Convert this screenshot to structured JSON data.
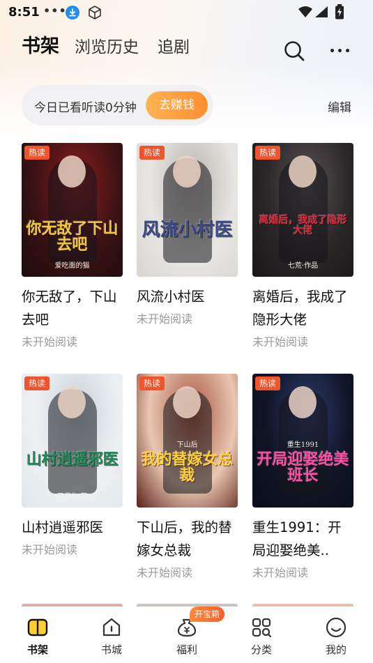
{
  "status_bar": {
    "time": "8:51",
    "dots": "•••"
  },
  "header": {
    "tabs": [
      {
        "label": "书架",
        "active": true
      },
      {
        "label": "浏览历史",
        "active": false
      },
      {
        "label": "追剧",
        "active": false
      }
    ]
  },
  "reading": {
    "text": "今日已看听读0分钟",
    "earn_label": "去赚钱"
  },
  "edit_label": "编辑",
  "books": [
    {
      "title": "你无敌了，下山去吧",
      "status": "未开始阅读",
      "badge": "热读",
      "cover_text": "你无敌了下山去吧",
      "cover_small": "爱吃面的猫",
      "colors": [
        "#3a1214",
        "#8a1c1c",
        "#1d0b0b"
      ],
      "cover_color": "#f4c83a"
    },
    {
      "title": "风流小村医",
      "status": "未开始阅读",
      "badge": "热读",
      "cover_text": "风流小村医",
      "cover_small": "",
      "colors": [
        "#e8e6e3",
        "#b9b4ae",
        "#d9d6d2"
      ],
      "cover_color": "#3b4a8c"
    },
    {
      "title": "离婚后，我成了隐形大佬",
      "status": "未开始阅读",
      "badge": "热读",
      "cover_text": "离婚后，我成了隐形大佬",
      "cover_small": "七荒·作品",
      "colors": [
        "#2a2628",
        "#575052",
        "#1a1718"
      ],
      "cover_color": "#e0283a"
    },
    {
      "title": "山村逍遥邪医",
      "status": "未开始阅读",
      "badge": "热读",
      "cover_text": "山村逍遥邪医",
      "cover_small": "三月生·著",
      "colors": [
        "#eef1f3",
        "#c8d2d8",
        "#dfe6ea"
      ],
      "cover_color": "#1f8a5a"
    },
    {
      "title": "下山后，我的替嫁女总裁",
      "status": "未开始阅读",
      "badge": "热读",
      "cover_text": "我的替嫁女总裁",
      "cover_small": "下山后",
      "colors": [
        "#e9c7b2",
        "#a8553e",
        "#5a1e19"
      ],
      "cover_color": "#ffcf3a"
    },
    {
      "title": "重生1991：开局迎娶绝美..",
      "status": "未开始阅读",
      "badge": "热读",
      "cover_text": "开局迎娶绝美班长",
      "cover_small": "重生1991",
      "colors": [
        "#101425",
        "#2a3a6a",
        "#0a0d18"
      ],
      "cover_color": "#ff4fa8"
    }
  ],
  "bottom_nav": [
    {
      "label": "书架",
      "icon": "bookshelf-icon",
      "active": true
    },
    {
      "label": "书城",
      "icon": "bookstore-icon",
      "active": false
    },
    {
      "label": "福利",
      "icon": "welfare-bag-icon",
      "active": false
    },
    {
      "label": "分类",
      "icon": "category-icon",
      "active": false
    },
    {
      "label": "我的",
      "icon": "profile-icon",
      "active": false
    }
  ],
  "treasure_badge": "开宝箱",
  "accent_color": "#ff9a3c",
  "hot_badge_color": "#f0542d"
}
